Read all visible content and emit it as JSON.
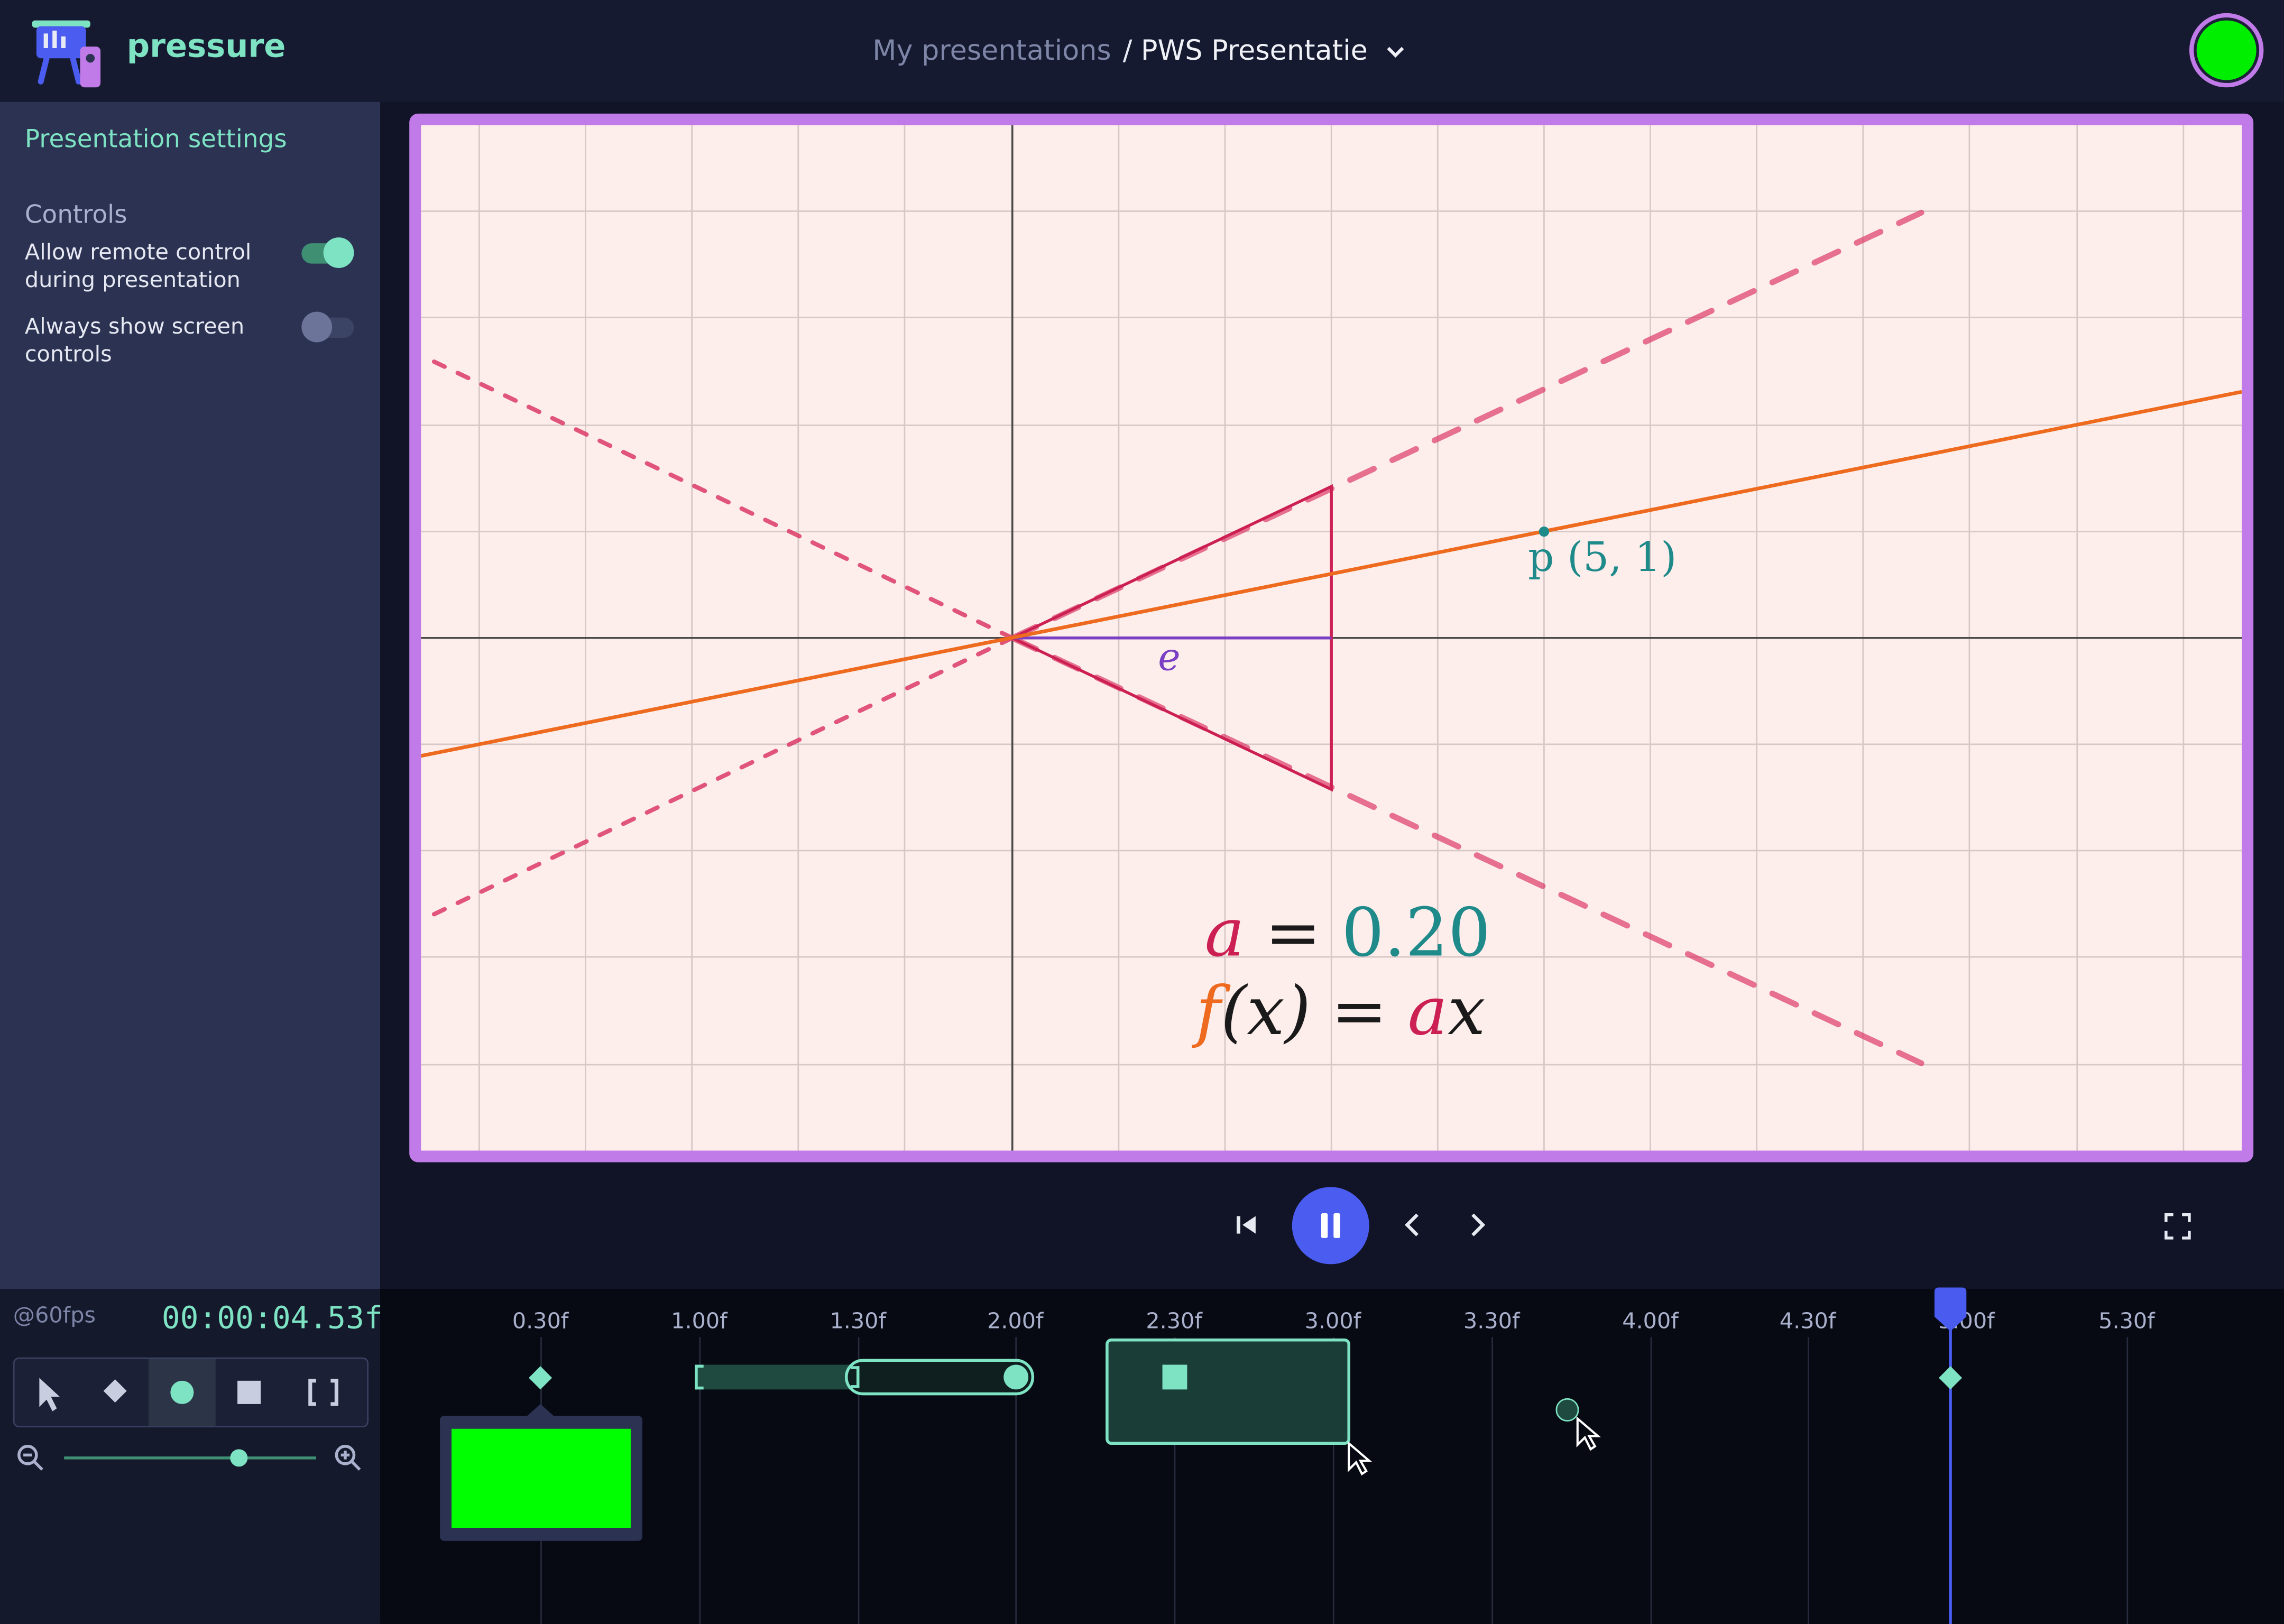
{
  "app": {
    "name": "pressure",
    "logo_icon": "presentation-easel-icon"
  },
  "breadcrumb": {
    "parent": "My presentations",
    "separator": "/",
    "current": "PWS Presentatie"
  },
  "sidebar": {
    "title": "Presentation settings",
    "section": "Controls",
    "toggles": [
      {
        "label": "Allow remote control during presentation",
        "on": true
      },
      {
        "label": "Always show screen controls",
        "on": false
      }
    ]
  },
  "slide": {
    "point_label": "p (5, 1)",
    "segment_label": "e",
    "equation_a": {
      "var": "a",
      "eq": "=",
      "value": "0.20"
    },
    "equation_f": {
      "f": "f",
      "args": "(x)",
      "eq": "=",
      "a": "a",
      "x": "x"
    },
    "colors": {
      "line": "#ee6a1e",
      "dashed": "#dc3a66",
      "triangle": "#cc2055",
      "point": "#1f8a8a",
      "segment": "#7a3fc2",
      "background": "#fdeeec",
      "frame": "#c07be8"
    }
  },
  "transport": {
    "icons": [
      "skip-to-start-icon",
      "pause-icon",
      "chevron-left-icon",
      "chevron-right-icon",
      "fullscreen-icon"
    ]
  },
  "timeline": {
    "fps": "@60fps",
    "timecode": "00:00:04.53f",
    "ticks": [
      "0.30f",
      "1.00f",
      "1.30f",
      "2.00f",
      "2.30f",
      "3.00f",
      "3.30f",
      "4.00f",
      "4.30f",
      "5.00f",
      "5.30f"
    ],
    "playhead_tick": "5.00f",
    "thumbnail_color": "#00ff00",
    "accent": "#7de3c3",
    "playhead_color": "#4a5cf0"
  }
}
